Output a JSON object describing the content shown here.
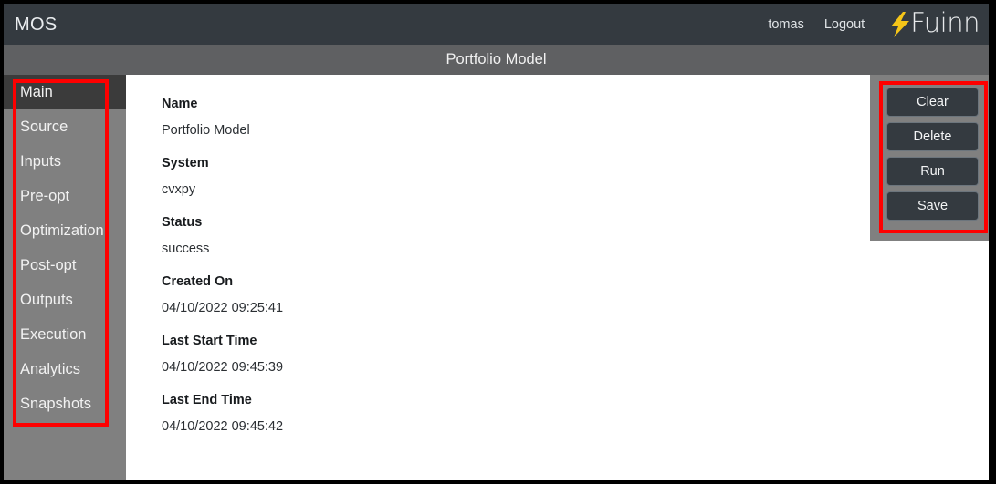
{
  "navbar": {
    "brand": "MOS",
    "username": "tomas",
    "logout_label": "Logout",
    "logo_text": "Fuinn",
    "logo_bolt_color": "#f5c518",
    "background": "#343a40"
  },
  "titlebar": {
    "title": "Portfolio Model",
    "background": "#5f6062"
  },
  "sidebar": {
    "background": "#808080",
    "active_background": "#3b3b3b",
    "items": [
      {
        "label": "Main",
        "active": true
      },
      {
        "label": "Source",
        "active": false
      },
      {
        "label": "Inputs",
        "active": false
      },
      {
        "label": "Pre-opt",
        "active": false
      },
      {
        "label": "Optimization",
        "active": false
      },
      {
        "label": "Post-opt",
        "active": false
      },
      {
        "label": "Outputs",
        "active": false
      },
      {
        "label": "Execution",
        "active": false
      },
      {
        "label": "Analytics",
        "active": false
      },
      {
        "label": "Snapshots",
        "active": false
      }
    ]
  },
  "content": {
    "fields": [
      {
        "label": "Name",
        "value": "Portfolio Model"
      },
      {
        "label": "System",
        "value": "cvxpy"
      },
      {
        "label": "Status",
        "value": "success"
      },
      {
        "label": "Created On",
        "value": "04/10/2022 09:25:41"
      },
      {
        "label": "Last Start Time",
        "value": "04/10/2022 09:45:39"
      },
      {
        "label": "Last End Time",
        "value": "04/10/2022 09:45:42"
      }
    ]
  },
  "actions": {
    "background": "#808080",
    "buttons": [
      {
        "label": "Clear"
      },
      {
        "label": "Delete"
      },
      {
        "label": "Run"
      },
      {
        "label": "Save"
      }
    ]
  },
  "annotations": {
    "highlight_color": "#fe0000"
  }
}
